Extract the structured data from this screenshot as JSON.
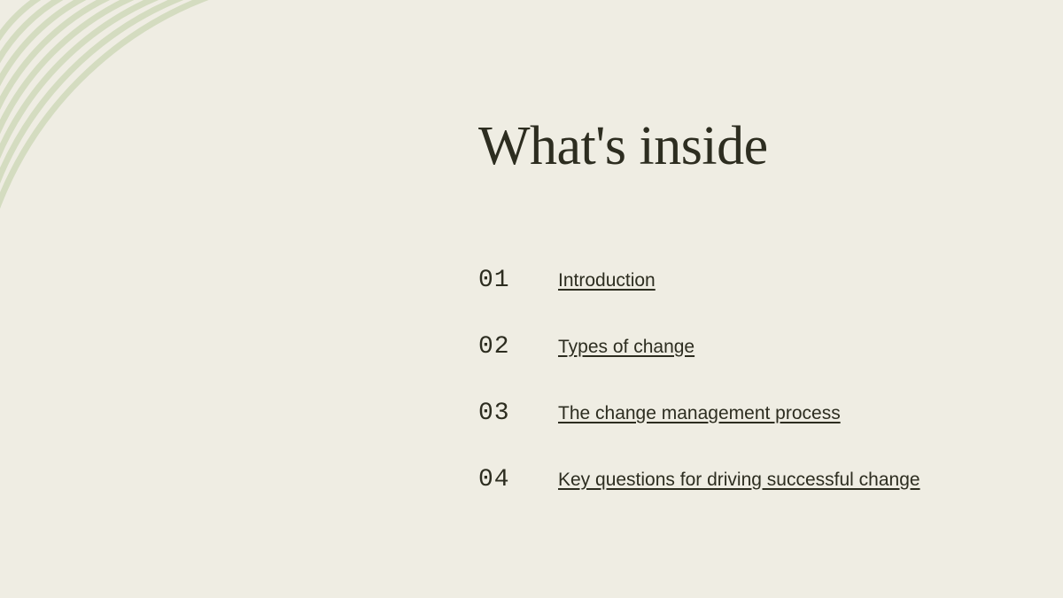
{
  "title": "What's inside",
  "toc": [
    {
      "number": "01",
      "label": "Introduction"
    },
    {
      "number": "02",
      "label": "Types of change"
    },
    {
      "number": "03",
      "label": "The change management process"
    },
    {
      "number": "04",
      "label": "Key questions for driving successful change"
    }
  ],
  "colors": {
    "background": "#efede3",
    "arc_stroke": "#d4dcc0",
    "text": "#2d2d20"
  }
}
